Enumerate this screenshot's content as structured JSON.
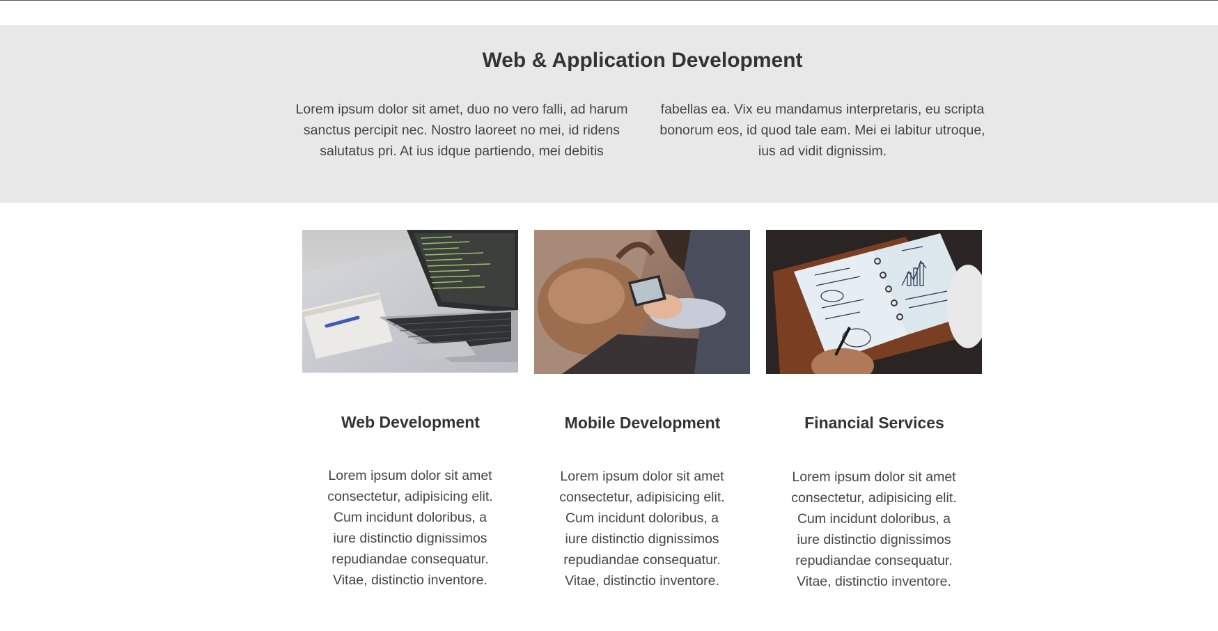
{
  "hero": {
    "title": "Web & Application Development",
    "paragraph_left": "Lorem ipsum dolor sit amet, duo no vero falli, ad harum sanctus percipit nec. Nostro laoreet no mei, id ridens salutatus pri. At ius idque partiendo, mei debitis",
    "paragraph_right": "fabellas ea. Vix eu mandamus interpretaris, eu scripta bonorum eos, id quod tale eam. Mei ei labitur utroque, ius ad vidit dignissim."
  },
  "services": [
    {
      "title": "Web Development",
      "image_icon": "laptop-code-photo",
      "text": "Lorem ipsum dolor sit amet consectetur, adipisicing elit. Cum incidunt doloribus, a iure distinctio dignissimos repudiandae consequatur. Vitae, distinctio inventore."
    },
    {
      "title": "Mobile Development",
      "image_icon": "person-phone-photo",
      "text": "Lorem ipsum dolor sit amet consectetur, adipisicing elit. Cum incidunt doloribus, a iure distinctio dignissimos repudiandae consequatur. Vitae, distinctio inventore."
    },
    {
      "title": "Financial Services",
      "image_icon": "finance-notebook-photo",
      "text": "Lorem ipsum dolor sit amet consectetur, adipisicing elit. Cum incidunt doloribus, a iure distinctio dignissimos repudiandae consequatur. Vitae, distinctio inventore."
    }
  ]
}
